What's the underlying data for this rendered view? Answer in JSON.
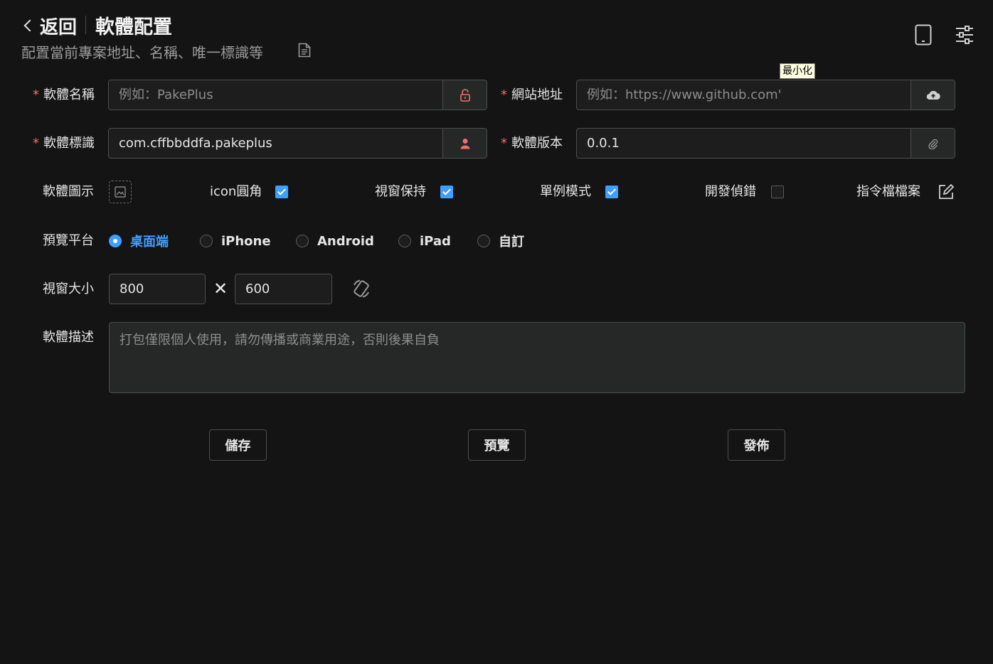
{
  "header": {
    "back_label": "返回",
    "title": "軟體配置",
    "subtitle": "配置當前專案地址、名稱、唯一標識等"
  },
  "icons": {
    "doc": "document-icon",
    "device": "tablet-icon",
    "settings": "sliders-icon",
    "lock": "lock-icon",
    "cloud": "cloud-upload-icon",
    "user": "user-icon",
    "clip": "paperclip-icon",
    "image": "image-icon",
    "edit": "edit-icon",
    "rotate": "rotate-icon"
  },
  "tooltip": "最小化",
  "form": {
    "app_name": {
      "label": "軟體名稱",
      "placeholder": "例如：PakePlus",
      "value": ""
    },
    "url": {
      "label": "網站地址",
      "placeholder": "例如：https://www.github.com'",
      "value": ""
    },
    "app_id": {
      "label": "軟體標識",
      "value": "com.cffbbddfa.pakeplus"
    },
    "version": {
      "label": "軟體版本",
      "value": "0.0.1"
    },
    "required_mark": "*",
    "icon_label": "軟體圖示",
    "options": [
      {
        "label": "icon圓角",
        "checked": true
      },
      {
        "label": "視窗保持",
        "checked": true
      },
      {
        "label": "單例模式",
        "checked": true
      },
      {
        "label": "開發偵錯",
        "checked": false
      }
    ],
    "script_label": "指令檔檔案",
    "platform_label": "預覽平台",
    "platforms": [
      {
        "label": "桌面端",
        "selected": true
      },
      {
        "label": "iPhone",
        "selected": false
      },
      {
        "label": "Android",
        "selected": false
      },
      {
        "label": "iPad",
        "selected": false
      },
      {
        "label": "自訂",
        "selected": false
      }
    ],
    "window_size_label": "視窗大小",
    "width": "800",
    "height": "600",
    "times_symbol": "✕",
    "desc_label": "軟體描述",
    "desc_placeholder": "打包僅限個人使用，請勿傳播或商業用途，否則後果自負"
  },
  "buttons": {
    "save": "儲存",
    "preview": "預覽",
    "publish": "發佈"
  },
  "colors": {
    "background": "#141414",
    "accent": "#409eff",
    "danger": "#f56c6c"
  }
}
